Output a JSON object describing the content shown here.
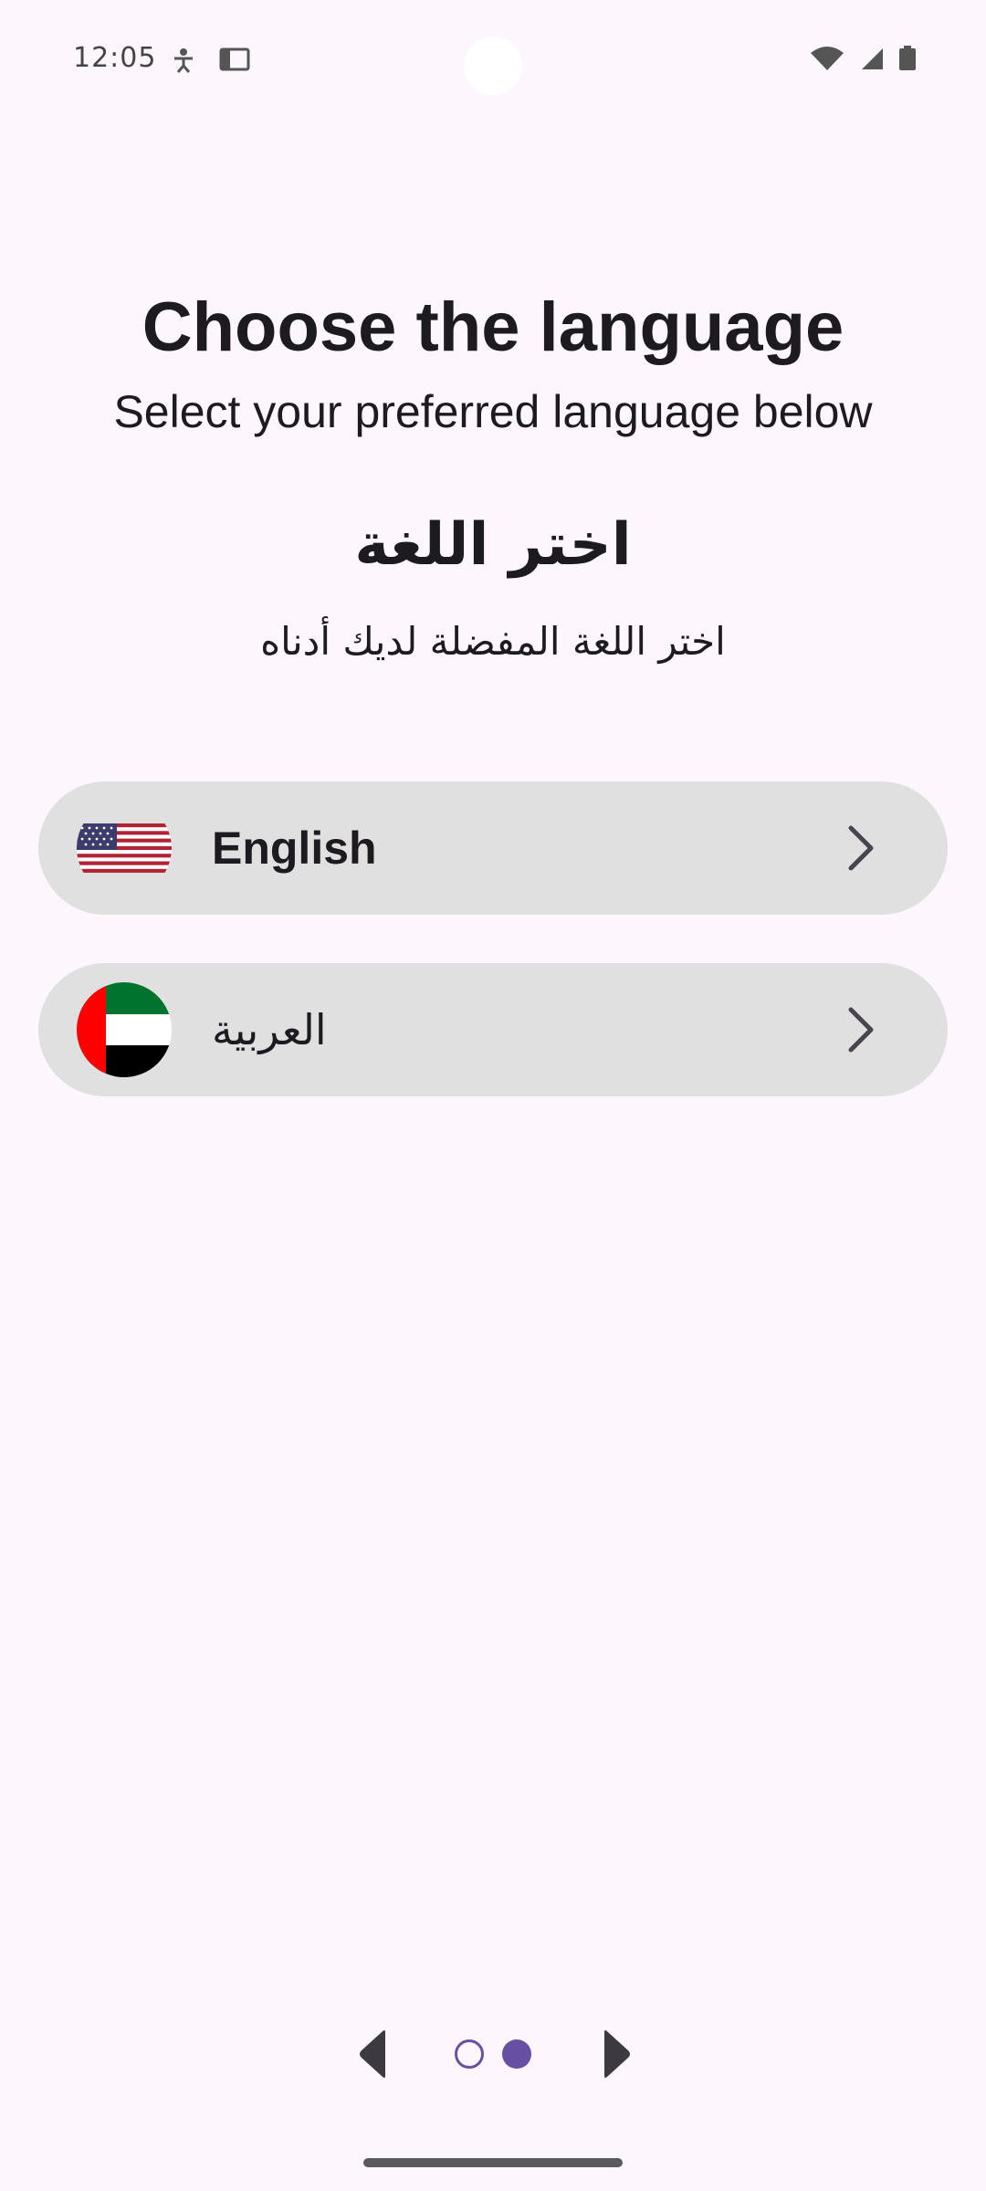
{
  "status_bar": {
    "time": "12:05",
    "left_icons": [
      "accessibility-icon",
      "screen-icon"
    ],
    "right_icons": [
      "wifi-icon",
      "signal-icon",
      "battery-icon"
    ]
  },
  "header": {
    "title_en": "Choose the language",
    "subtitle_en": "Select your preferred language below",
    "title_ar": "اختر اللغة",
    "subtitle_ar": "اختر اللغة المفضلة لديك أدناه"
  },
  "languages": [
    {
      "label": "English",
      "flag": "us-flag-icon",
      "icon": "chevron-right-icon"
    },
    {
      "label": "العربية",
      "flag": "uae-flag-icon",
      "icon": "chevron-right-icon"
    }
  ],
  "pager": {
    "prev_icon": "arrow-left-icon",
    "next_icon": "arrow-right-icon",
    "page_count": 2,
    "current_page": 2
  },
  "colors": {
    "background": "#fdf7fd",
    "option_background": "#e0e0e0",
    "accent": "#6750a4",
    "text": "#1d1b20"
  }
}
